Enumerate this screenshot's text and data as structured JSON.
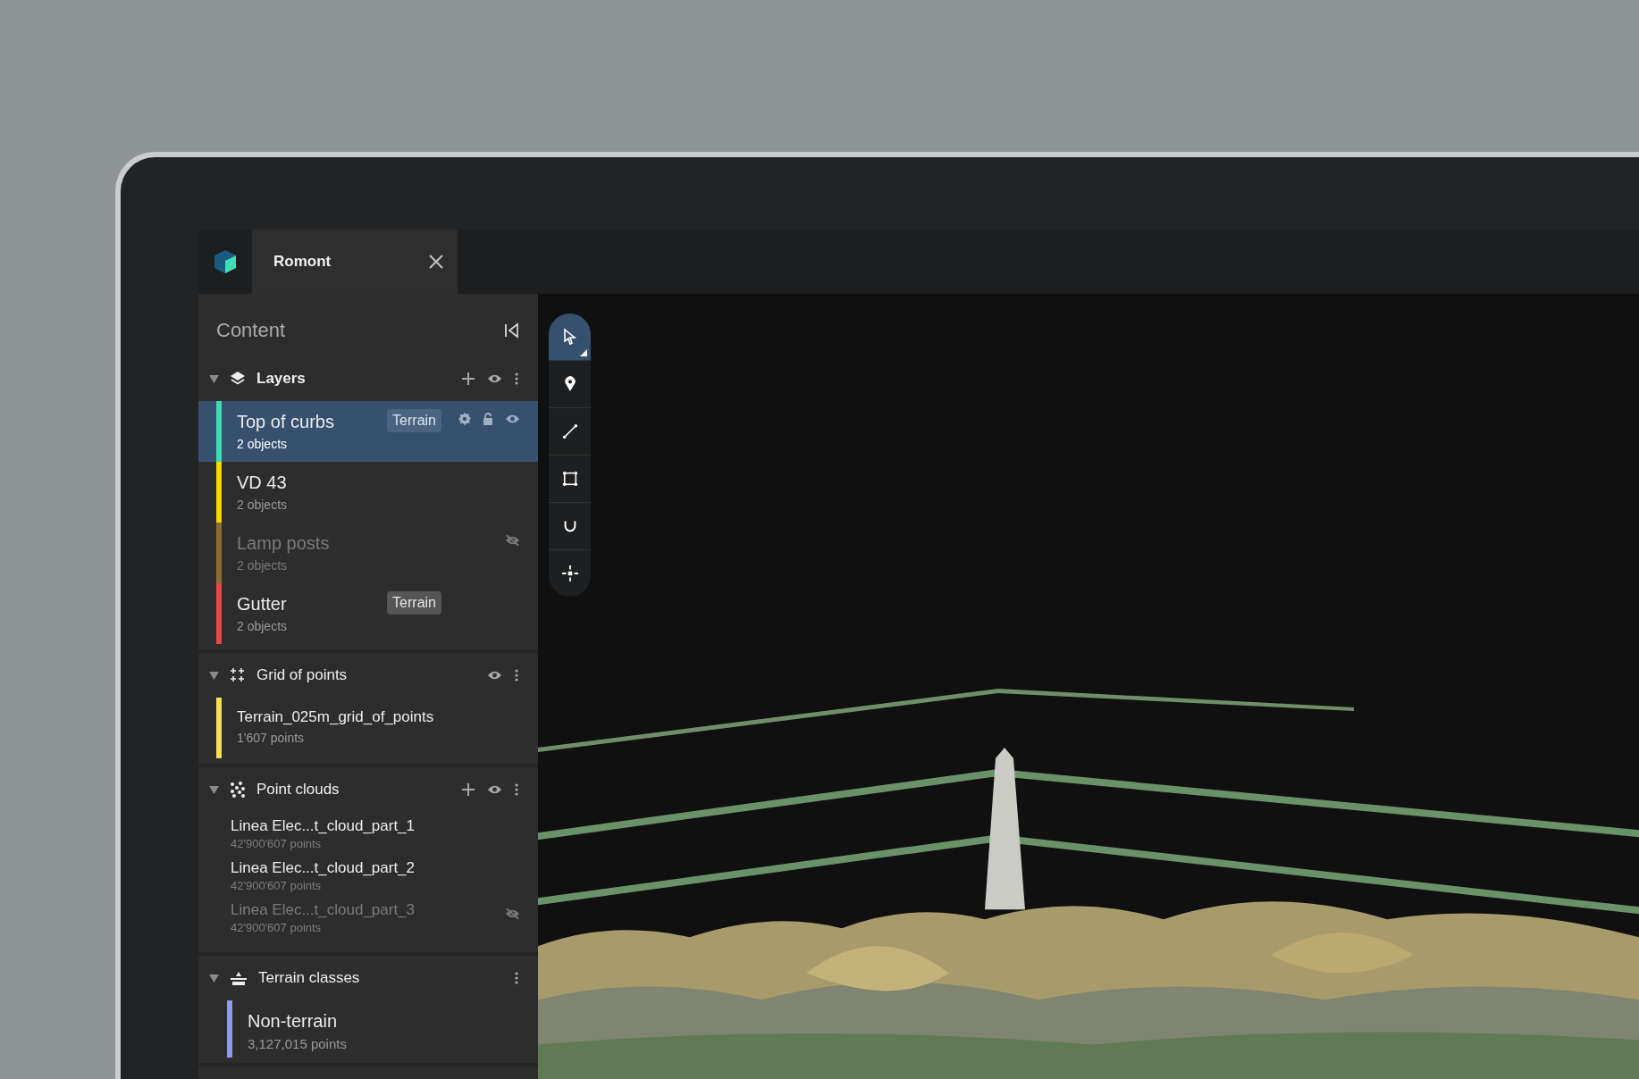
{
  "tab": {
    "title": "Romont"
  },
  "panel": {
    "title": "Content"
  },
  "sections": [
    {
      "kind": "layers",
      "title": "Layers",
      "expanded": true,
      "can_add": true,
      "show_eye": true,
      "items": [
        {
          "name": "Top of curbs",
          "count": "2 objects",
          "color": "#3fd9b4",
          "selected": true,
          "hidden": false,
          "tag": "Terrain"
        },
        {
          "name": "VD 43",
          "count": "2 objects",
          "color": "#f2d600",
          "selected": false,
          "hidden": false
        },
        {
          "name": "Lamp posts",
          "count": "2 objects",
          "color": "#8a6d35",
          "selected": false,
          "hidden": true
        },
        {
          "name": "Gutter",
          "count": "2 objects",
          "color": "#e8474c",
          "selected": false,
          "hidden": false,
          "tag": "Terrain"
        }
      ]
    },
    {
      "kind": "grid",
      "title": "Grid of points",
      "expanded": true,
      "can_add": false,
      "show_eye": true,
      "items": [
        {
          "name": "Terrain_025m_grid_of_points",
          "count": "1'607 points",
          "color": "#f0e05a",
          "selected": false,
          "hidden": false
        }
      ]
    },
    {
      "kind": "clouds",
      "title": "Point clouds",
      "expanded": true,
      "can_add": true,
      "show_eye": true,
      "items": [
        {
          "name": "Linea Elec...t_cloud_part_1",
          "count": "42'900'607 points",
          "selected": false,
          "hidden": false
        },
        {
          "name": "Linea Elec...t_cloud_part_2",
          "count": "42'900'607 points",
          "selected": false,
          "hidden": false
        },
        {
          "name": "Linea Elec...t_cloud_part_3",
          "count": "42'900'607 points",
          "selected": false,
          "hidden": true
        }
      ]
    },
    {
      "kind": "terrain",
      "title": "Terrain classes",
      "expanded": true,
      "can_add": false,
      "show_eye": false,
      "items": [
        {
          "name": "Non-terrain",
          "count": "3,127,015 points",
          "color": "#8b9cf0",
          "selected": false,
          "hidden": false
        }
      ]
    }
  ],
  "tools": [
    {
      "kind": "select",
      "selected": true
    },
    {
      "kind": "pin",
      "selected": false
    },
    {
      "kind": "line",
      "selected": false
    },
    {
      "kind": "area",
      "selected": false
    },
    {
      "kind": "magnet",
      "selected": false
    },
    {
      "kind": "move",
      "selected": false
    }
  ]
}
